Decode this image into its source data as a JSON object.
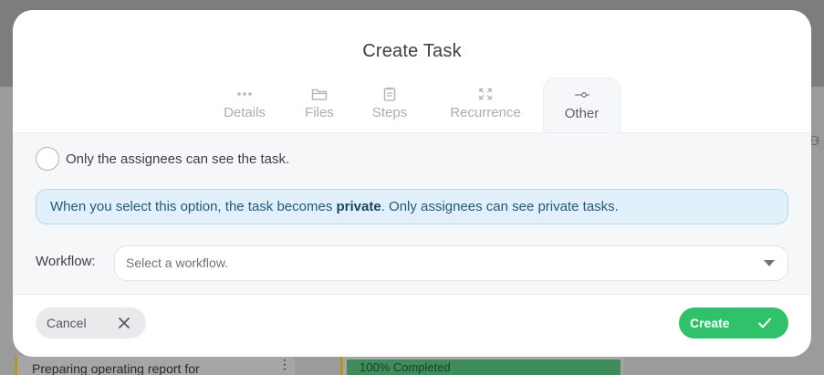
{
  "background": {
    "left_card_title": "Preparing operating report for",
    "left_card_menu_glyph": "⋮",
    "right_card_progress": "100% Completed",
    "user_icon_glyph": "⚇"
  },
  "modal": {
    "title": "Create Task",
    "tabs": [
      {
        "label": "Details",
        "icon": "more-dots-icon"
      },
      {
        "label": "Files",
        "icon": "folder-icon"
      },
      {
        "label": "Steps",
        "icon": "clipboard-icon"
      },
      {
        "label": "Recurrence",
        "icon": "recurrence-icon"
      },
      {
        "label": "Other",
        "icon": "slider-icon",
        "active": true
      }
    ],
    "other": {
      "private_checkbox_label": "Only the assignees can see the task.",
      "private_checked": false,
      "info_prefix": "When you select this option, the task becomes ",
      "info_bold": "private",
      "info_suffix": ". Only assignees can see private tasks.",
      "workflow_label": "Workflow:",
      "workflow_placeholder": "Select a workflow.",
      "workflow_value": ""
    },
    "footer": {
      "cancel_label": "Cancel",
      "create_label": "Create"
    }
  },
  "colors": {
    "accent_green": "#2fc26b",
    "info_bg": "#e1f0fb",
    "info_border": "#b4d9f2",
    "overlay": "#8e8e8e"
  }
}
